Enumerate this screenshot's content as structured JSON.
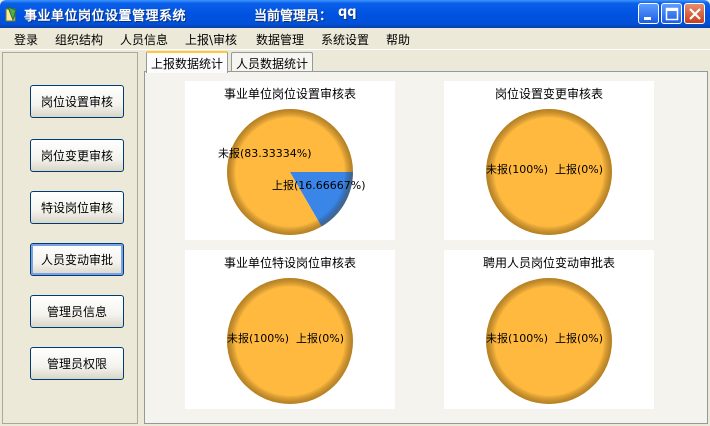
{
  "window": {
    "title": "事业单位岗位设置管理系统",
    "admin_label": "当前管理员：",
    "admin_name": "qq"
  },
  "menu": [
    "登录",
    "组织结构",
    "人员信息",
    "上报\\审核",
    "数据管理",
    "系统设置",
    "帮助"
  ],
  "nav": [
    "岗位设置审核",
    "岗位变更审核",
    "特设岗位审核",
    "人员变动审批",
    "管理员信息",
    "管理员权限"
  ],
  "tabs": [
    "上报数据统计",
    "人员数据统计"
  ],
  "colors": {
    "unreported": "#ffb93e",
    "reported": "#3a86e8"
  },
  "chart_data": [
    {
      "type": "pie",
      "title": "事业单位岗位设置审核表",
      "labels": [
        "未报(83.33334%)",
        "上报(16.66667%)"
      ],
      "values": [
        83.33334,
        16.66667
      ]
    },
    {
      "type": "pie",
      "title": "岗位设置变更审核表",
      "labels": [
        "未报(100%)",
        "上报(0%)"
      ],
      "values": [
        100,
        0
      ]
    },
    {
      "type": "pie",
      "title": "事业单位特设岗位审核表",
      "labels": [
        "未报(100%)",
        "上报(0%)"
      ],
      "values": [
        100,
        0
      ]
    },
    {
      "type": "pie",
      "title": "聘用人员岗位变动审批表",
      "labels": [
        "未报(100%)",
        "上报(0%)"
      ],
      "values": [
        100,
        0
      ]
    }
  ]
}
